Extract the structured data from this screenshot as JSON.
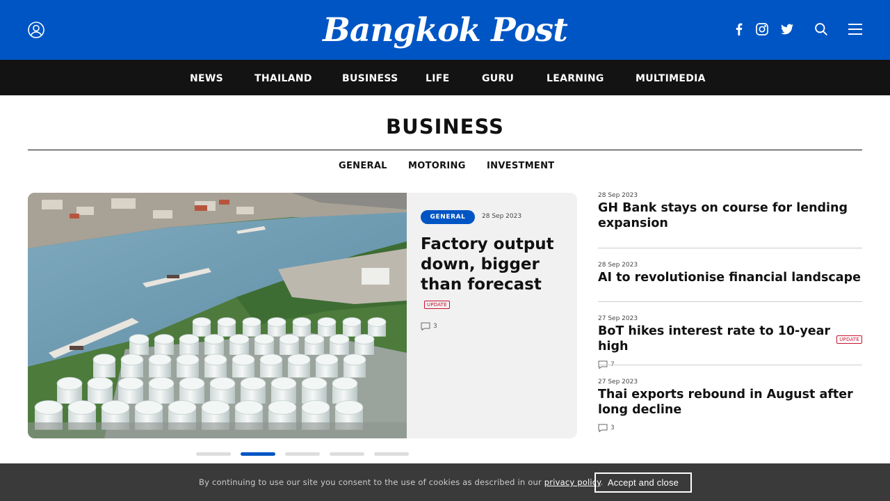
{
  "header": {
    "logo_text": "Bangkok Post",
    "icons": [
      "user-icon",
      "facebook-icon",
      "instagram-icon",
      "twitter-icon",
      "search-icon",
      "menu-icon"
    ],
    "brand_color": "#0055c4"
  },
  "nav": {
    "items": [
      "NEWS",
      "THAILAND",
      "BUSINESS",
      "LIFE",
      "GURU",
      "LEARNING",
      "MULTIMEDIA"
    ]
  },
  "section": {
    "title": "BUSINESS",
    "subnav": [
      "GENERAL",
      "MOTORING",
      "INVESTMENT"
    ]
  },
  "feature": {
    "tag": "GENERAL",
    "date": "28 Sep 2023",
    "title": "Factory output down, bigger than forecast",
    "badge": "UPDATE",
    "comments": "3",
    "image": "aerial-oil-storage-tanks-riverside"
  },
  "carousel": {
    "count": 5,
    "active_index": 1
  },
  "stories": [
    {
      "date": "28 Sep 2023",
      "title": "GH Bank stays on course for lending expansion"
    },
    {
      "date": "28 Sep 2023",
      "title": "AI to revolutionise financial landscape"
    },
    {
      "date": "27 Sep 2023",
      "title": "BoT hikes interest rate to 10-year high",
      "badge": "UPDATE",
      "comments": "7"
    },
    {
      "date": "27 Sep 2023",
      "title": "Thai exports rebound in August after long decline",
      "comments": "3"
    }
  ],
  "cookie": {
    "text": "By continuing to use our site you consent to the use of cookies as described in our",
    "link": "privacy policy",
    "suffix": ".",
    "button": "Accept and close"
  }
}
